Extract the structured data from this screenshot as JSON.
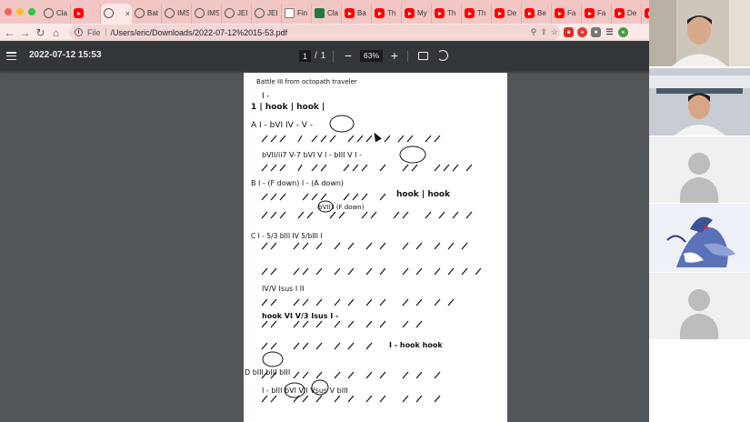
{
  "browser": {
    "tabs": [
      {
        "icon": "globe",
        "title": "Cla"
      },
      {
        "icon": "youtube",
        "title": ""
      },
      {
        "icon": "globe",
        "title": "",
        "active": true
      },
      {
        "icon": "globe",
        "title": "Bat"
      },
      {
        "icon": "globe",
        "title": "IMS"
      },
      {
        "icon": "globe",
        "title": "IMS"
      },
      {
        "icon": "globe",
        "title": "JEI"
      },
      {
        "icon": "globe",
        "title": "JEI"
      },
      {
        "icon": "doc",
        "title": "Fin"
      },
      {
        "icon": "excel",
        "title": "Cla"
      },
      {
        "icon": "youtube",
        "title": "Ba"
      },
      {
        "icon": "youtube",
        "title": "Th"
      },
      {
        "icon": "youtube",
        "title": "My"
      },
      {
        "icon": "youtube",
        "title": "Th"
      },
      {
        "icon": "youtube",
        "title": "Th"
      },
      {
        "icon": "youtube",
        "title": "De"
      },
      {
        "icon": "youtube",
        "title": "Be"
      },
      {
        "icon": "youtube",
        "title": "Fa"
      },
      {
        "icon": "youtube",
        "title": "Fa"
      },
      {
        "icon": "youtube",
        "title": "De"
      },
      {
        "icon": "youtube",
        "title": ""
      }
    ],
    "address": {
      "scheme": "File",
      "url": "/Users/eric/Downloads/2022-07-12%2015-53.pdf"
    },
    "colors": {
      "tabstrip": "#f2c6c4",
      "toolbar": "#fbe9e8"
    }
  },
  "pdf": {
    "title": "2022-07-12 15:53",
    "page_current": "1",
    "page_divider": "/",
    "page_total": "1",
    "zoom": "63%",
    "toolbar_color": "#323639",
    "background_color": "#525659"
  },
  "sheet": {
    "heading": "Battle III from octopath traveler",
    "lines": [
      {
        "text": "I -"
      },
      {
        "text": "1 | hook | hook |"
      },
      {
        "text": "A  I -         bVI        IV - V -"
      },
      {
        "text": "bVII/ii7  V-7 bVI  V  I -        bIII  V  I -"
      },
      {
        "text": "B  I - (F down)               I - (A down)"
      },
      {
        "text": "hook | hook"
      },
      {
        "text": "bVII  I (F down)"
      },
      {
        "text": "C  I -  5/3 bIII   IV   5/bIII  I"
      },
      {
        "text": "IV/V  Isus  I   II"
      },
      {
        "text": "hook     VI  V/3     Isus  I -"
      },
      {
        "text": "I -  hook   hook"
      },
      {
        "text": "D  bIII      bIII   bIII"
      },
      {
        "text": "I -   bIII  bVI    VII     Vsus  V bIII"
      }
    ]
  },
  "meeting": {
    "participants": [
      {
        "kind": "speaker-video"
      },
      {
        "kind": "video"
      },
      {
        "kind": "no-video"
      },
      {
        "kind": "artwork"
      },
      {
        "kind": "no-video"
      }
    ]
  }
}
